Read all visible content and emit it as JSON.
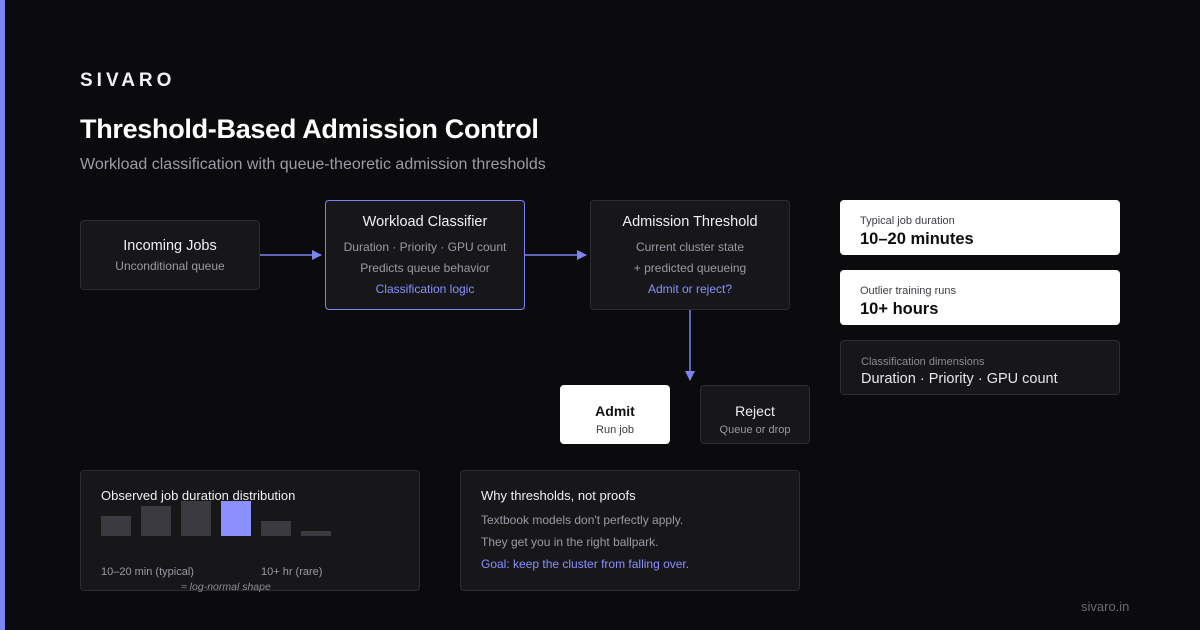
{
  "brand": "SIVARO",
  "title": "Threshold-Based Admission Control",
  "subtitle": "Workload classification with queue-theoretic admission thresholds",
  "nodes": {
    "incoming": {
      "title": "Incoming Jobs",
      "lines": [
        "Unconditional queue"
      ]
    },
    "classifier": {
      "title": "Workload Classifier",
      "lines": [
        "Duration · Priority · GPU count",
        "Predicts queue behavior"
      ],
      "accent": "Classification logic"
    },
    "threshold": {
      "title": "Admission Threshold",
      "lines": [
        "Current cluster state",
        "+ predicted queueing"
      ],
      "accent": "Admit or reject?"
    },
    "admit": {
      "title": "Admit",
      "label": "Run job"
    },
    "reject": {
      "title": "Reject",
      "label": "Queue or drop"
    }
  },
  "stats": [
    {
      "label": "Typical job duration",
      "value": "10–20 minutes"
    },
    {
      "label": "Outlier training runs",
      "value": "10+ hours"
    },
    {
      "label": "Classification dimensions",
      "value": "Duration · Priority · GPU count"
    }
  ],
  "distribution": {
    "title": "Observed job duration distribution",
    "bars": [
      {
        "level": 0.57,
        "highlight": false
      },
      {
        "level": 0.86,
        "highlight": false
      },
      {
        "level": 1.0,
        "highlight": false
      },
      {
        "level": 1.0,
        "highlight": true
      },
      {
        "level": 0.43,
        "highlight": false
      },
      {
        "level": 0.14,
        "highlight": false
      }
    ],
    "label_left": "10–20 min (typical)",
    "label_right": "10+ hr (rare)",
    "note": "≈ log-normal shape"
  },
  "why": {
    "title": "Why thresholds, not proofs",
    "lines": [
      "Textbook models don't perfectly apply.",
      "They get you in the right ballpark."
    ],
    "accent": "Goal: keep the cluster from falling over."
  },
  "footer": "sivaro.in",
  "colors": {
    "accent": "#7c83f2",
    "background": "#0b0b0d",
    "bar": "#3a3a40",
    "bar_highlight": "#8a90ff"
  }
}
